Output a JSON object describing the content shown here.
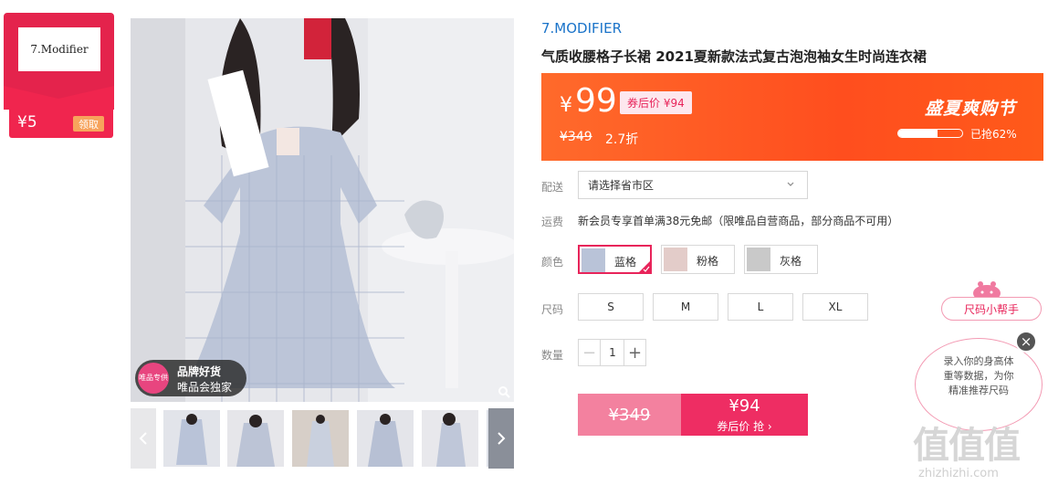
{
  "coupon": {
    "logo_text": "7.Modifier",
    "amount": "¥5",
    "claim": "领取"
  },
  "gallery": {
    "badge_circle": "唯品专供",
    "badge_line1": "品牌好货",
    "badge_line2": "唯品会独家",
    "thumb_count": 5
  },
  "product": {
    "brand": "7.MODIFIER",
    "title": "气质收腰格子长裙 2021夏新款法式复古泡泡袖女生时尚连衣裙"
  },
  "price": {
    "currency": "¥",
    "current": "99",
    "after_coupon_label": "券后价 ¥94",
    "original": "¥349",
    "discount": "2.7折",
    "festival": "盛夏爽购节",
    "sold_percent": 0.62,
    "sold_text": "已抢62%"
  },
  "delivery": {
    "label": "配送",
    "placeholder": "请选择省市区"
  },
  "shipping": {
    "label": "运费",
    "text": "新会员专享首单满38元免邮（限唯品自营商品，部分商品不可用）"
  },
  "colors": {
    "label": "颜色",
    "options": [
      {
        "name": "蓝格",
        "selected": true,
        "swatch": "#b9c3d8"
      },
      {
        "name": "粉格",
        "selected": false,
        "swatch": "#e3ccc9"
      },
      {
        "name": "灰格",
        "selected": false,
        "swatch": "#c9c9c9"
      }
    ]
  },
  "sizes": {
    "label": "尺码",
    "options": [
      "S",
      "M",
      "L",
      "XL"
    ]
  },
  "quantity": {
    "label": "数量",
    "minus": "−",
    "value": "1",
    "plus": "+"
  },
  "buy": {
    "original": "¥349",
    "after_price": "¥94",
    "after_label": "券后价 抢 ›"
  },
  "size_helper": {
    "button": "尺码小帮手",
    "line1": "录入你的身高体",
    "line2": "重等数据，为你",
    "line3": "精准推荐尺码",
    "close": "×"
  },
  "watermark": {
    "glyphs": "值值值",
    "url": "zhizhizhi.com"
  },
  "colors_theme": {
    "accent": "#e8245a",
    "banner": "#ff5a1f",
    "brand_link": "#1a73c9"
  }
}
